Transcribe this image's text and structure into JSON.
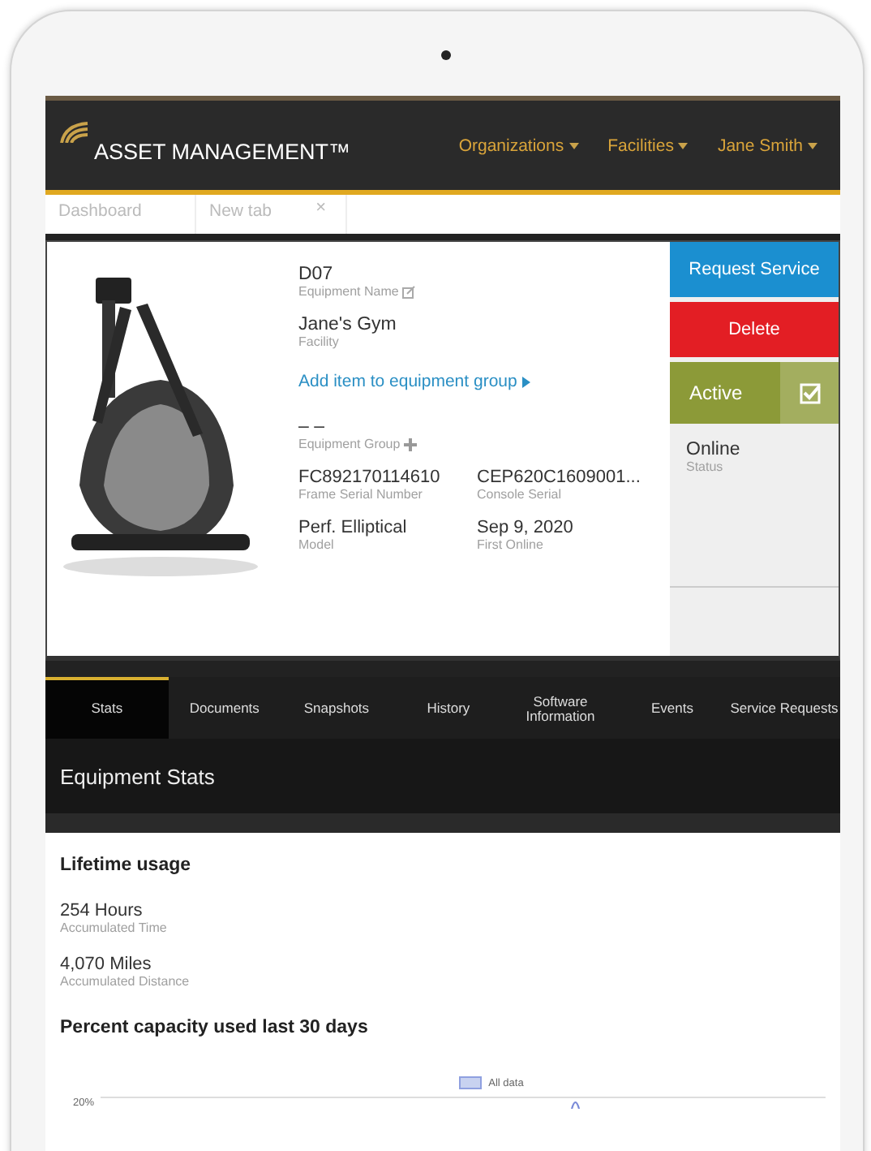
{
  "header": {
    "logo": "ASSET MANAGEMENT™",
    "menus": [
      {
        "label": "Organizations"
      },
      {
        "label": "Facilities"
      },
      {
        "label": "Jane Smith"
      }
    ]
  },
  "browser_tabs": [
    {
      "label": "Dashboard"
    },
    {
      "label": "New tab",
      "close": "×"
    }
  ],
  "equipment": {
    "picture": {
      "kind": "picture"
    },
    "fields": [
      {
        "kind": "editable",
        "value": "D07",
        "label": "Equipment Name"
      },
      {
        "kind": "plain",
        "value": "Jane's Gym",
        "label": "Facility"
      },
      {
        "kind": "link",
        "link": "Add item to equipment group"
      },
      {
        "kind": "addable",
        "value": "– –",
        "label": "Equipment Group"
      }
    ],
    "pairs": [
      [
        {
          "value": "FC892170114610",
          "label": "Frame Serial Number"
        },
        {
          "value": "CEP620C1609001...",
          "label": "Console Serial"
        }
      ],
      [
        {
          "value": "Perf. Elliptical",
          "label": "Model"
        },
        {
          "value": "Sep 9, 2020",
          "label": "First Online"
        }
      ]
    ],
    "actions": [
      {
        "kind": "button",
        "label": "Request Service",
        "color": "#1b8fd0"
      },
      {
        "kind": "button",
        "label": "Delete",
        "color": "#e31e24"
      },
      {
        "kind": "toggle",
        "label": "Active",
        "checked": true,
        "color": "#8c9a38"
      }
    ],
    "status": {
      "value": "Online",
      "label": "Status"
    }
  },
  "nav_tabs": [
    {
      "label": "Stats",
      "selected": true
    },
    {
      "label": "Documents",
      "selected": false
    },
    {
      "label": "Snapshots",
      "selected": false
    },
    {
      "label": "History",
      "selected": false
    },
    {
      "label": "Software Information",
      "selected": false
    },
    {
      "label": "Events",
      "selected": false
    },
    {
      "label": "Service Requests",
      "selected": false
    }
  ],
  "section_title": "Equipment Stats",
  "card": {
    "title": "Lifetime usage",
    "stats": [
      {
        "value": "254 Hours",
        "label": "Accumulated Time"
      },
      {
        "value": "4,070 Miles",
        "label": "Accumulated Distance"
      }
    ],
    "chart_title": "Percent capacity used last 30 days",
    "chart": {
      "legend": "All data",
      "ytick": "20%"
    }
  }
}
